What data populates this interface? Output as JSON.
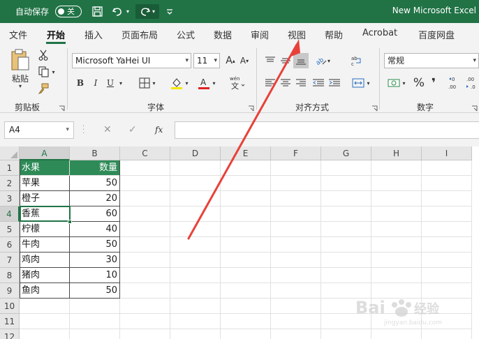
{
  "titlebar": {
    "autosave_label": "自动保存",
    "toggle_state": "关",
    "app_title": "New Microsoft Excel",
    "bg_color": "#217346"
  },
  "tabs": [
    {
      "label": "文件",
      "active": false
    },
    {
      "label": "开始",
      "active": true
    },
    {
      "label": "插入",
      "active": false
    },
    {
      "label": "页面布局",
      "active": false
    },
    {
      "label": "公式",
      "active": false
    },
    {
      "label": "数据",
      "active": false
    },
    {
      "label": "审阅",
      "active": false
    },
    {
      "label": "视图",
      "active": false
    },
    {
      "label": "帮助",
      "active": false
    },
    {
      "label": "Acrobat",
      "active": false
    },
    {
      "label": "百度网盘",
      "active": false
    }
  ],
  "ribbon": {
    "clipboard": {
      "paste_label": "粘贴",
      "group_label": "剪贴板"
    },
    "font": {
      "font_name": "Microsoft YaHei UI",
      "font_size": "11",
      "bold": "B",
      "italic": "I",
      "underline": "U",
      "group_label": "字体"
    },
    "alignment": {
      "group_label": "对齐方式"
    },
    "number": {
      "format": "常规",
      "group_label": "数字"
    }
  },
  "formula_bar": {
    "name_box": "A4",
    "fx_label": "fx",
    "formula": ""
  },
  "sheet": {
    "columns": [
      "A",
      "B",
      "C",
      "D",
      "E",
      "F",
      "G",
      "H",
      "I"
    ],
    "rows": [
      "1",
      "2",
      "3",
      "4",
      "5",
      "6",
      "7",
      "8",
      "9",
      "10",
      "11",
      "12"
    ],
    "selected_cell": "A4",
    "header_color": "#2e8b57",
    "table": {
      "headers": [
        "水果",
        "数量"
      ],
      "rows": [
        [
          "苹果",
          "50"
        ],
        [
          "橙子",
          "20"
        ],
        [
          "香蕉",
          "60"
        ],
        [
          "柠檬",
          "40"
        ],
        [
          "牛肉",
          "50"
        ],
        [
          "鸡肉",
          "30"
        ],
        [
          "猪肉",
          "10"
        ],
        [
          "鱼肉",
          "50"
        ]
      ]
    }
  },
  "annotation": {
    "arrow_color": "#e8413a",
    "points_to": "视图"
  },
  "watermark": {
    "text": "Bai 经验",
    "sub": "jingyan.baidu.com"
  }
}
